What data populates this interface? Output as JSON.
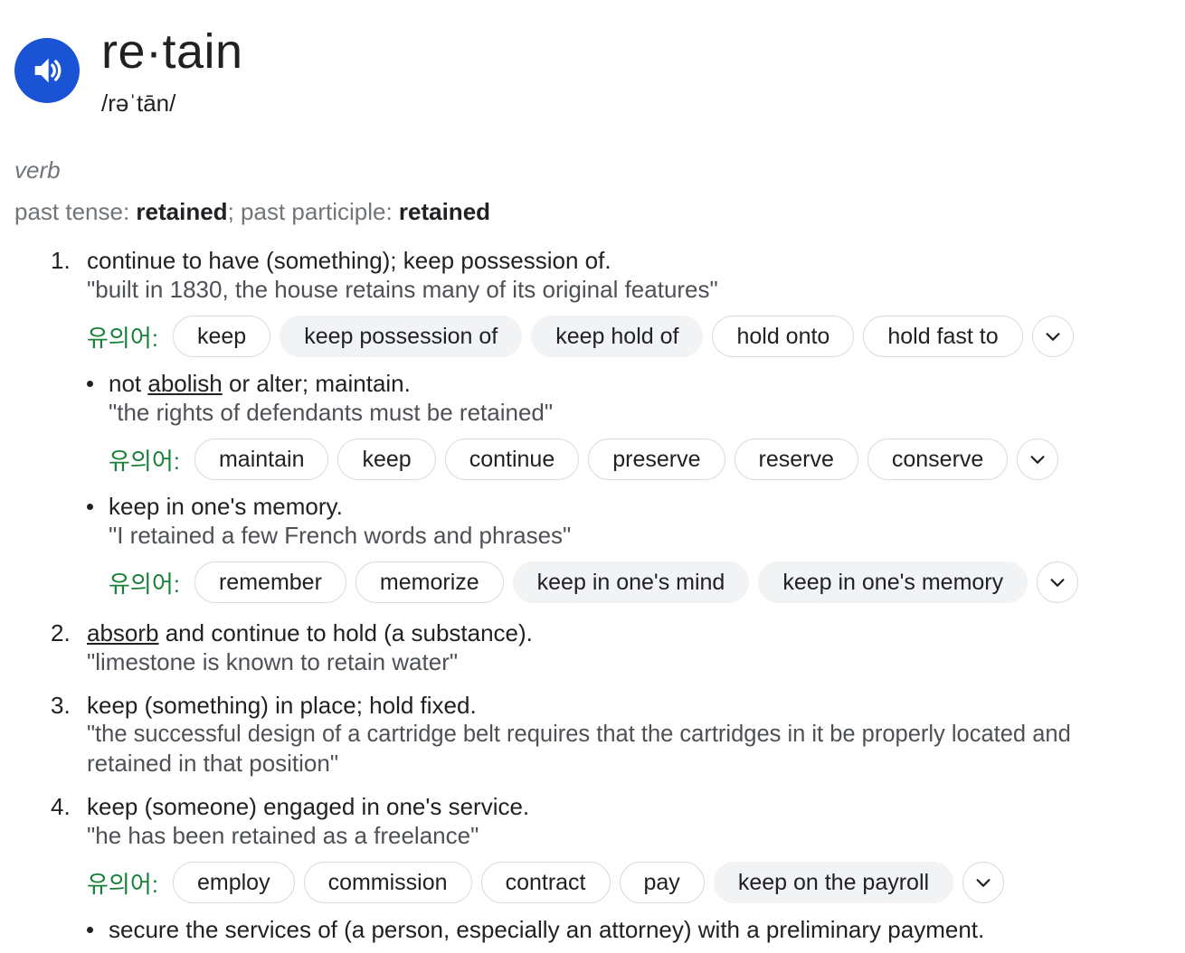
{
  "entry": {
    "word": "re·tain",
    "phonetic": "/rəˈtān/",
    "pos": "verb",
    "forms": {
      "past_tense_label": "past tense: ",
      "past_tense": "retained",
      "sep": "; past participle: ",
      "past_participle": "retained"
    }
  },
  "synonym_label": "유의어:",
  "senses": {
    "s1": {
      "num": "1.",
      "def": "continue to have (something); keep possession of.",
      "example": "\"built in 1830, the house retains many of its original features\"",
      "synonyms": [
        "keep",
        "keep possession of",
        "keep hold of",
        "hold onto",
        "hold fast to"
      ]
    },
    "s1a": {
      "def_pre": "not ",
      "def_link": "abolish",
      "def_post": " or alter; maintain.",
      "example": "\"the rights of defendants must be retained\"",
      "synonyms": [
        "maintain",
        "keep",
        "continue",
        "preserve",
        "reserve",
        "conserve"
      ]
    },
    "s1b": {
      "def": "keep in one's memory.",
      "example": "\"I retained a few French words and phrases\"",
      "synonyms": [
        "remember",
        "memorize",
        "keep in one's mind",
        "keep in one's memory"
      ]
    },
    "s2": {
      "num": "2.",
      "def_link": "absorb",
      "def_post": " and continue to hold (a substance).",
      "example": "\"limestone is known to retain water\""
    },
    "s3": {
      "num": "3.",
      "def": "keep (something) in place; hold fixed.",
      "example_line1": "\"the successful design of a cartridge belt requires that the cartridges in it be properly located and",
      "example_line2": "retained in that position\""
    },
    "s4": {
      "num": "4.",
      "def": "keep (someone) engaged in one's service.",
      "example": "\"he has been retained as a freelance\"",
      "synonyms": [
        "employ",
        "commission",
        "contract",
        "pay",
        "keep on the payroll"
      ]
    },
    "s4a": {
      "def": "secure the services of (a person, especially an attorney) with a preliminary payment."
    }
  },
  "colors": {
    "speaker_bg": "#1a53d3",
    "synonym_label": "#188038",
    "chip_filled": "#f1f3f4",
    "chip_border": "#dadce0"
  }
}
